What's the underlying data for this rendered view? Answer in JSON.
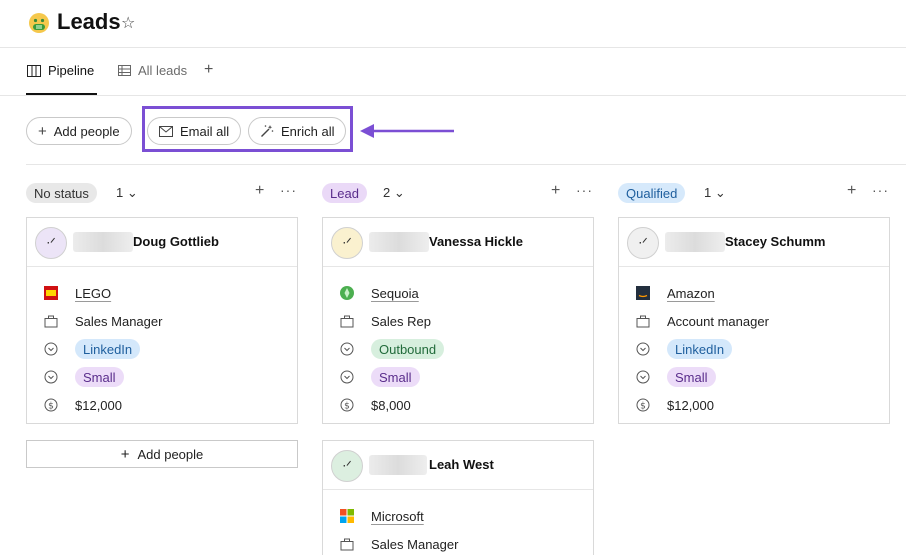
{
  "header": {
    "title": "Leads",
    "emoji_icon": "money-mouth-face-icon",
    "star_icon": "star-icon"
  },
  "tabs": [
    {
      "label": "Pipeline",
      "icon": "board-icon",
      "active": true
    },
    {
      "label": "All leads",
      "icon": "table-icon",
      "active": false
    }
  ],
  "toolbar": {
    "add_people": "Add people",
    "email_all": "Email all",
    "enrich_all": "Enrich all"
  },
  "annotation": {
    "highlight_color": "#7b4fd4"
  },
  "columns": [
    {
      "status": "No status",
      "count": "1",
      "pill_bg": "#e8e8e8",
      "pill_color": "#333333",
      "cards": [
        {
          "name": "Doug Gottlieb",
          "avatar_bg": "#ece4f7",
          "company": "LEGO",
          "company_icon": "lego-logo-icon",
          "role": "Sales Manager",
          "source": "LinkedIn",
          "source_bg": "#d4e8fb",
          "source_color": "#1f5f9e",
          "size": "Small",
          "amount": "$12,000"
        }
      ],
      "add_label": "Add people"
    },
    {
      "status": "Lead",
      "count": "2",
      "pill_bg": "#ead9f7",
      "pill_color": "#5a2d8c",
      "cards": [
        {
          "name": "Vanessa Hickle",
          "avatar_bg": "#faf1cf",
          "company": "Sequoia",
          "company_icon": "sequoia-logo-icon",
          "role": "Sales Rep",
          "source": "Outbound",
          "source_bg": "#d7efde",
          "source_color": "#226b3b",
          "size": "Small",
          "amount": "$8,000"
        },
        {
          "name": "Leah West",
          "avatar_bg": "#dcefe0",
          "company": "Microsoft",
          "company_icon": "microsoft-logo-icon",
          "role": "Sales Manager"
        }
      ]
    },
    {
      "status": "Qualified",
      "count": "1",
      "pill_bg": "#d6e9fb",
      "pill_color": "#1f5f9e",
      "cards": [
        {
          "name": "Stacey Schumm",
          "avatar_bg": "#f0f0f0",
          "company": "Amazon",
          "company_icon": "amazon-logo-icon",
          "role": "Account manager",
          "source": "LinkedIn",
          "source_bg": "#d4e8fb",
          "source_color": "#1f5f9e",
          "size": "Small",
          "amount": "$12,000"
        }
      ]
    }
  ],
  "size_tag": {
    "bg": "#ecdcf8",
    "color": "#5a2d8c"
  }
}
